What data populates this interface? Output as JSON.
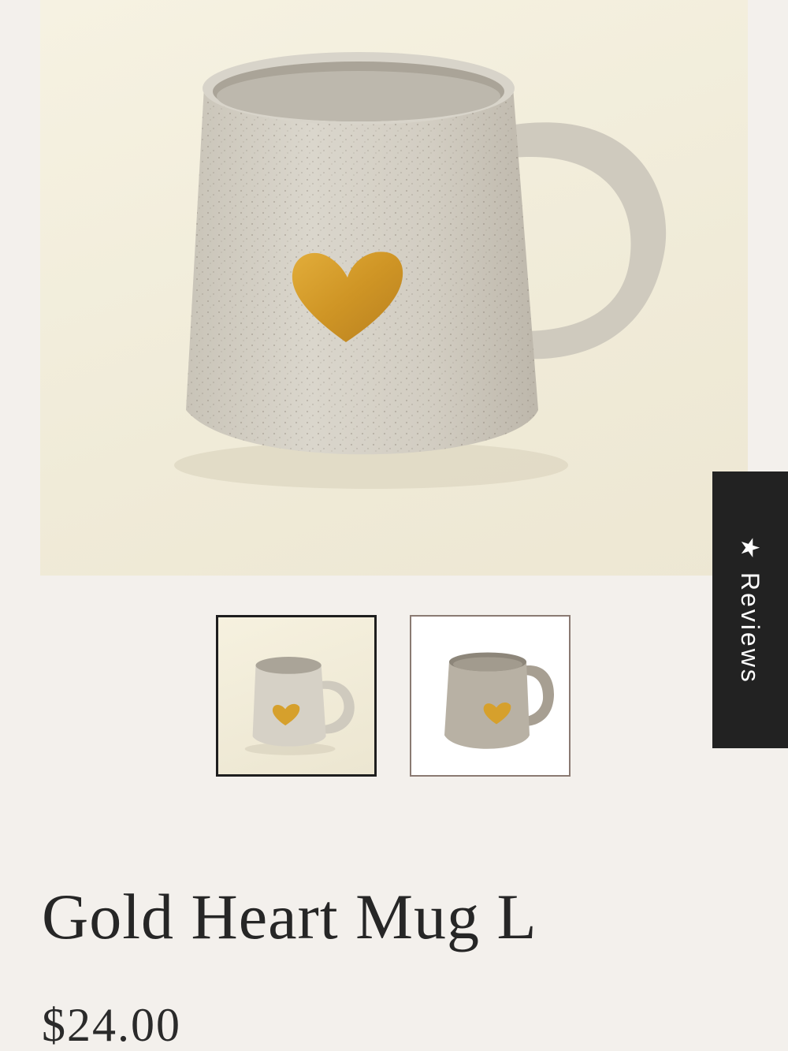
{
  "product": {
    "title": "Gold Heart Mug L",
    "price": "$24.00",
    "main_image": "gold heart mug photo",
    "thumbnails": [
      {
        "name": "mug-thumbnail-cream-background",
        "selected": true
      },
      {
        "name": "mug-thumbnail-white-background",
        "selected": false
      }
    ]
  },
  "reviews_tab": {
    "star": "★",
    "label": "Reviews"
  },
  "colors": {
    "page_background": "#f3f0ec",
    "accent_dark": "#222222",
    "heart_gold": "#d9a02a"
  }
}
